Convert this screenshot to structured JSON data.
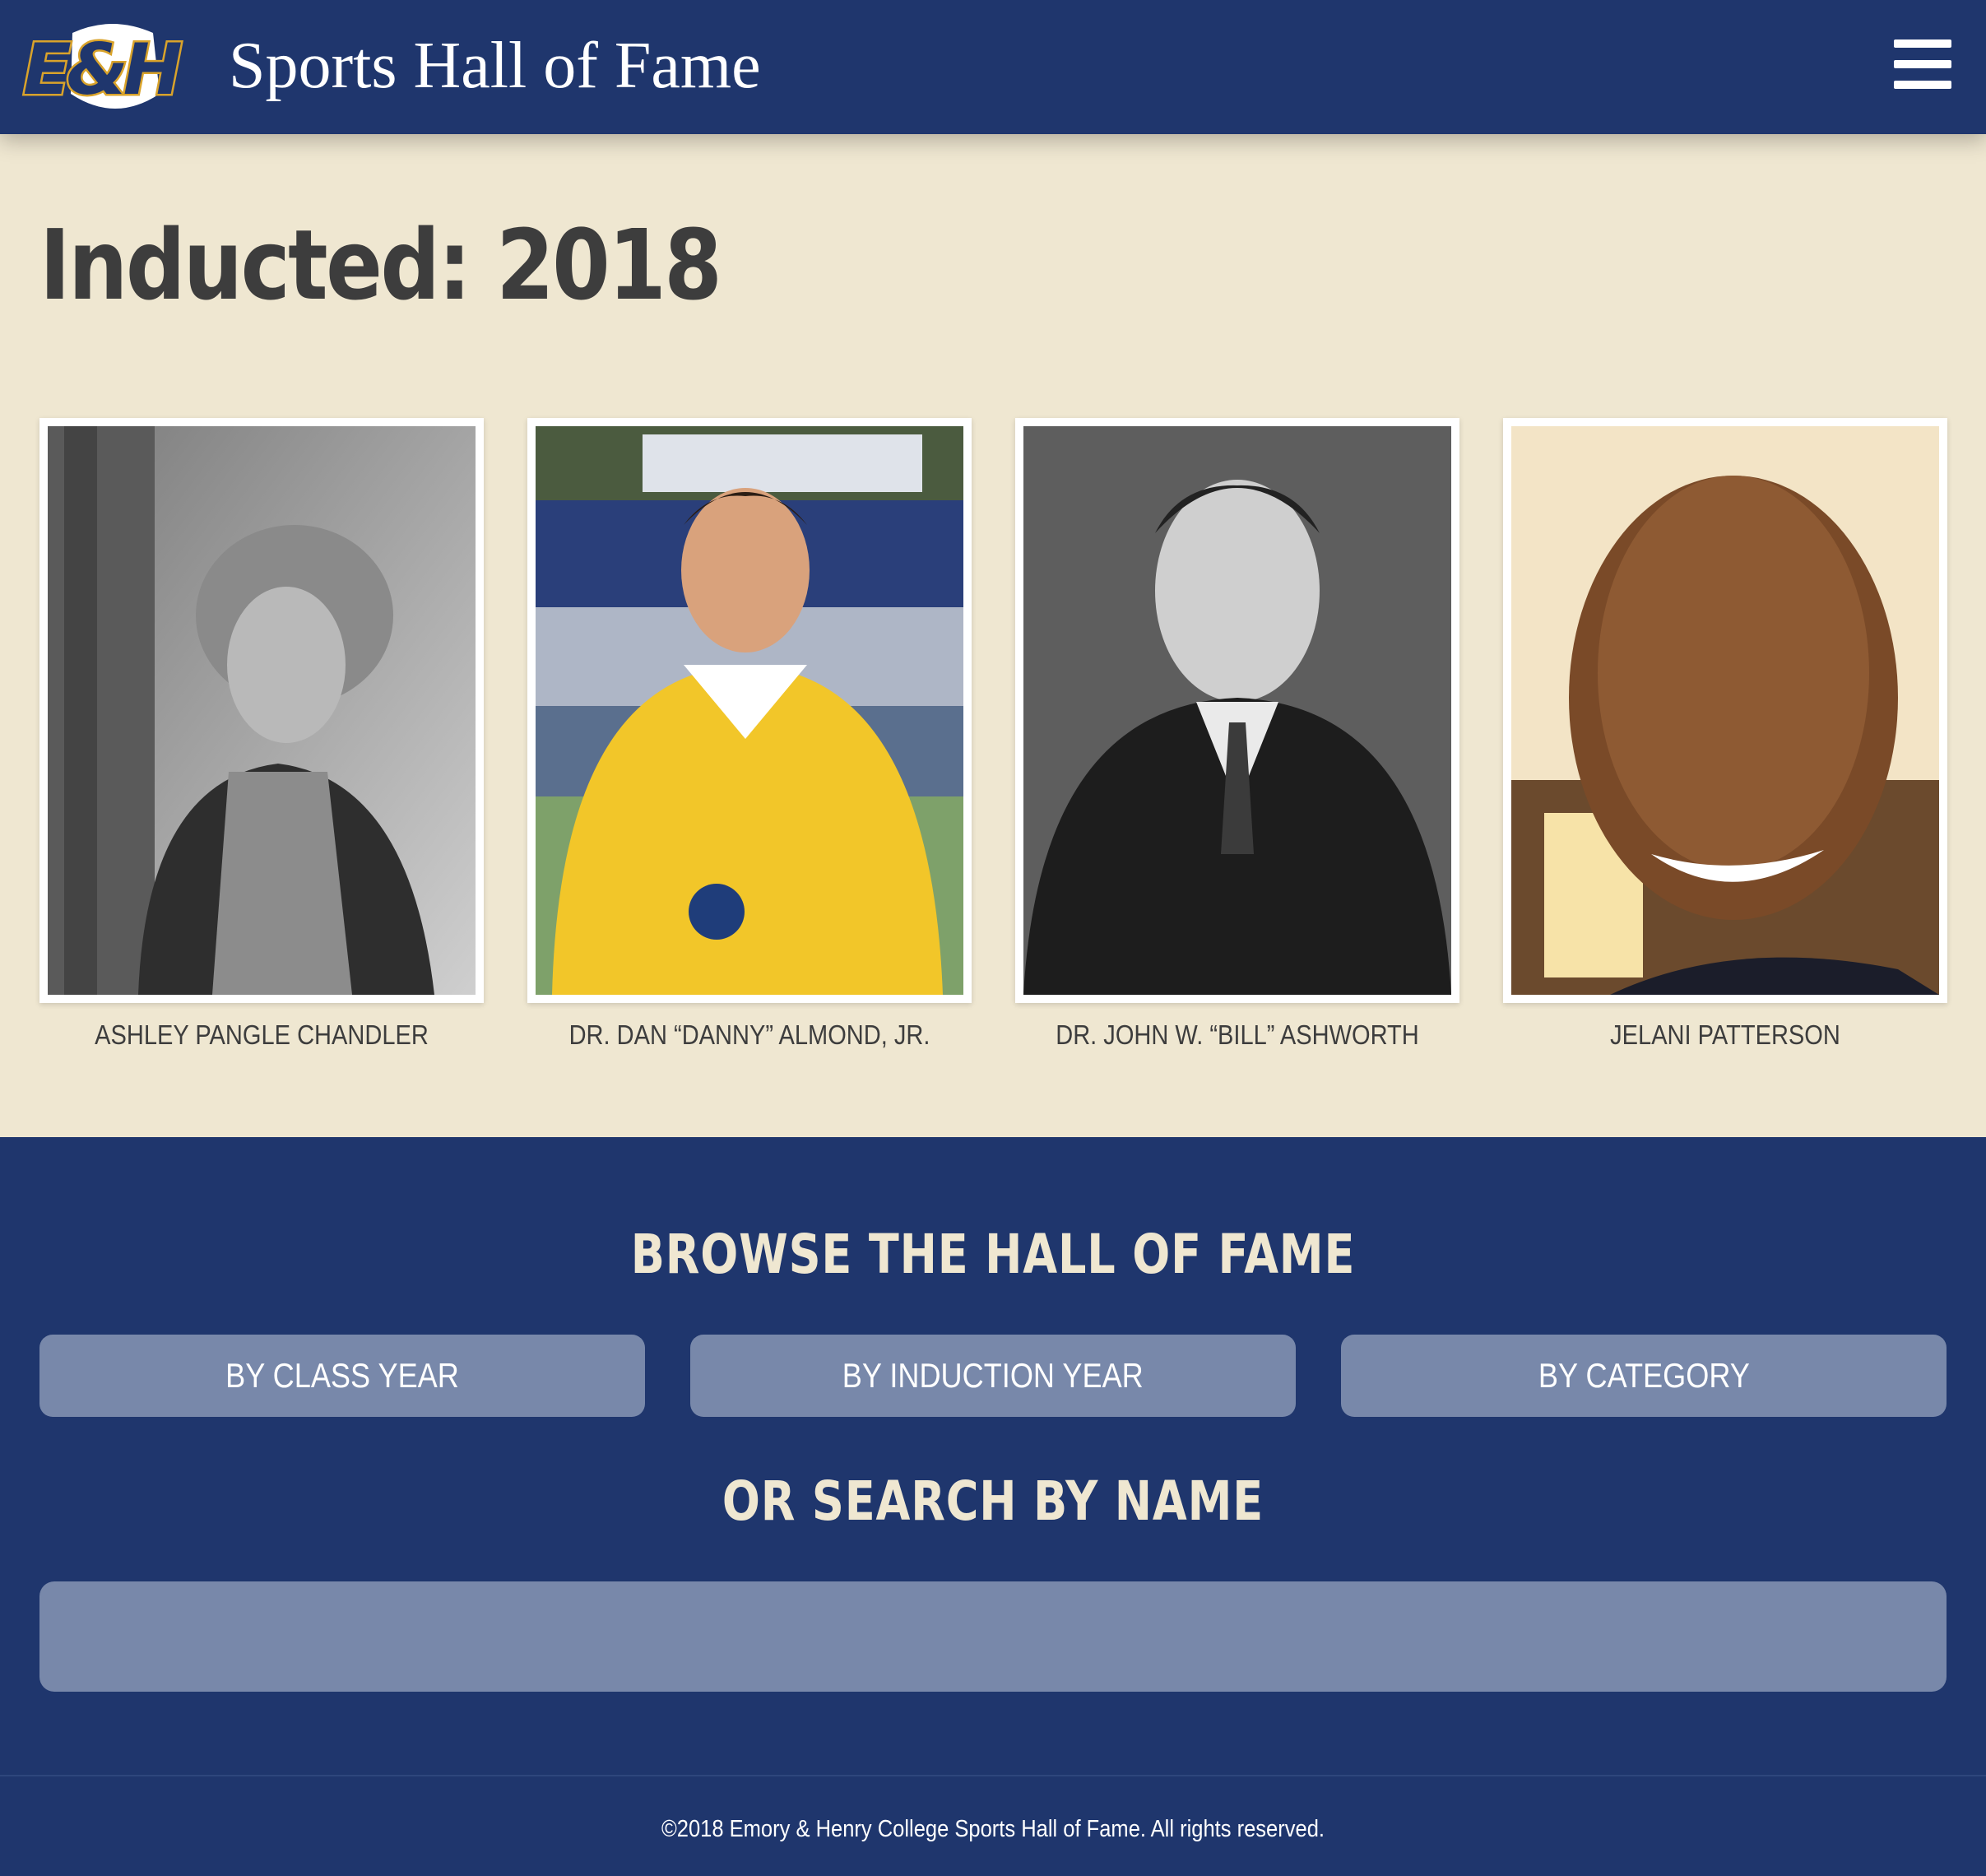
{
  "header": {
    "logo_text": "E&H",
    "site_title": "Sports Hall of Fame",
    "menu_icon": "hamburger-menu-icon"
  },
  "page": {
    "title": "Inducted: 2018"
  },
  "inductees": [
    {
      "name": "ASHLEY PANGLE CHANDLER"
    },
    {
      "name": "DR. DAN “DANNY” ALMOND, JR."
    },
    {
      "name": "DR. JOHN W. “BILL” ASHWORTH"
    },
    {
      "name": "JELANI PATTERSON"
    }
  ],
  "browse": {
    "heading": "BROWSE THE HALL OF FAME",
    "buttons": [
      {
        "label": "BY CLASS YEAR"
      },
      {
        "label": "BY INDUCTION YEAR"
      },
      {
        "label": "BY CATEGORY"
      }
    ],
    "search_heading": "OR SEARCH BY NAME",
    "search_value": "",
    "search_placeholder": ""
  },
  "footer": {
    "copyright": "©2018 Emory & Henry College Sports Hall of Fame. All rights reserved."
  },
  "colors": {
    "navy": "#1f366d",
    "cream": "#efe7d1",
    "button": "#7888aa",
    "gold": "#d9a32b"
  }
}
